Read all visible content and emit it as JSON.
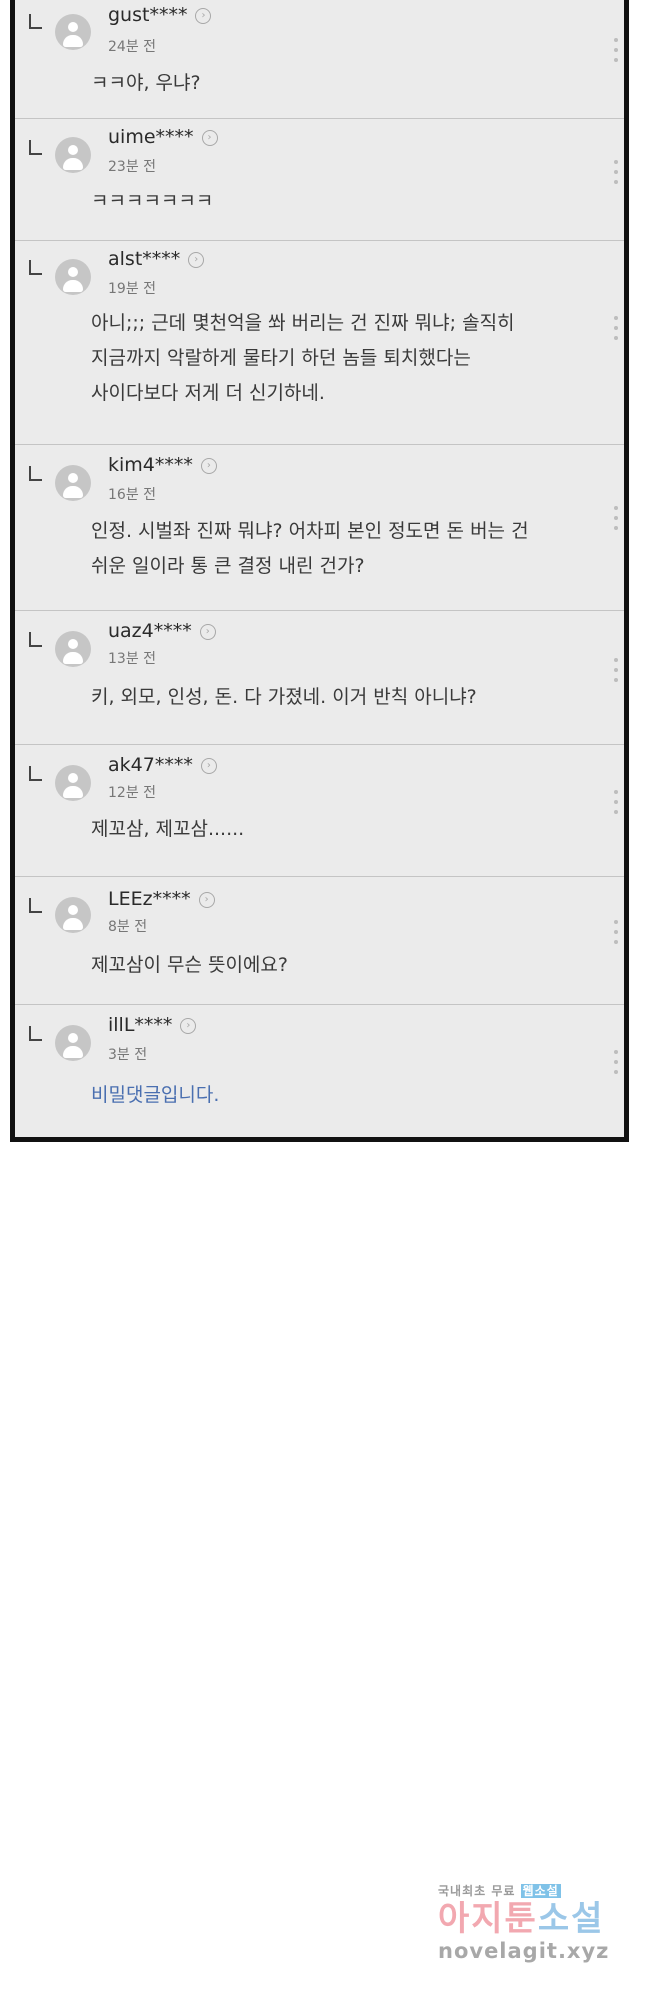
{
  "comments": [
    {
      "user": "gust****",
      "time": "24분 전",
      "lines": [
        "ㅋㅋ야, 우냐?"
      ]
    },
    {
      "user": "uime****",
      "time": "23분 전",
      "lines": [
        "ㅋㅋㅋㅋㅋㅋㅋ"
      ]
    },
    {
      "user": "alst****",
      "time": "19분 전",
      "lines": [
        "아니;;; 근데 몇천억을 쏴 버리는 건 진짜 뭐냐; 솔직히",
        "지금까지 악랄하게 물타기 하던 놈들 퇴치했다는",
        "사이다보다 저게 더 신기하네."
      ]
    },
    {
      "user": "kim4****",
      "time": "16분 전",
      "lines": [
        "인정. 시벌좌 진짜 뭐냐? 어차피 본인 정도면 돈 버는 건",
        "쉬운 일이라 통 큰 결정 내린 건가?"
      ]
    },
    {
      "user": "uaz4****",
      "time": "13분 전",
      "lines": [
        "키, 외모, 인성, 돈. 다 가졌네. 이거 반칙 아니냐?"
      ]
    },
    {
      "user": "ak47****",
      "time": "12분 전",
      "lines": [
        "제꼬삼, 제꼬삼......"
      ]
    },
    {
      "user": "LEEz****",
      "time": "8분 전",
      "lines": [
        "제꼬삼이 무슨 뜻이에요?"
      ]
    },
    {
      "user": "illL****",
      "time": "3분 전",
      "lines": [
        "비밀댓글입니다."
      ],
      "secret": true
    }
  ],
  "watermark": {
    "line1_a": "국내최초 무료",
    "line1_b": "웹소설",
    "line2_a": "아지툰",
    "line2_b": "소설",
    "line3": "novelagit.xyz"
  },
  "colors": {
    "panel_bg": "#ebebeb",
    "border": "#111111",
    "secret_text": "#4a6fb0"
  }
}
